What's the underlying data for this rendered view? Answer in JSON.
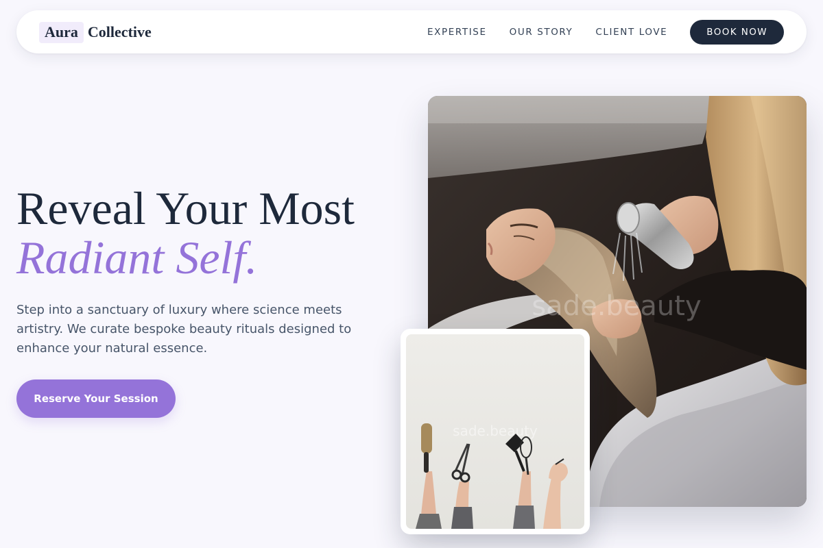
{
  "brand": {
    "mark": "Aura",
    "rest": "Collective"
  },
  "nav": {
    "links": [
      "EXPERTISE",
      "OUR STORY",
      "CLIENT LOVE"
    ],
    "cta_label": "BOOK NOW"
  },
  "hero": {
    "title_line1": "Reveal Your Most",
    "title_line2": "Radiant Self.",
    "description": "Step into a sanctuary of luxury where science meets artistry. We curate bespoke beauty rituals designed to enhance your natural essence.",
    "cta_label": "Reserve Your Session"
  },
  "images": {
    "main": {
      "watermark": "sade.beauty",
      "subject": "stylist washing client's hair at salon basin"
    },
    "secondary": {
      "watermark": "sade.beauty",
      "subject": "hands holding hair brush, scissors and tint brush"
    }
  },
  "colors": {
    "accent": "#9473d9",
    "dark": "#1e293b",
    "background": "#f8f7fd"
  }
}
